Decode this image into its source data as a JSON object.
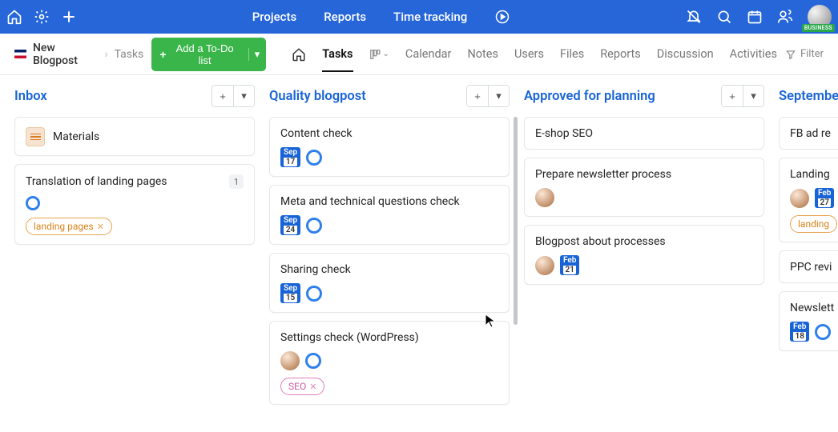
{
  "topnav": {
    "links": [
      "Projects",
      "Reports",
      "Time tracking"
    ],
    "avatar_badge": "BUSINESS"
  },
  "breadcrumb": {
    "project": "New Blogpost",
    "section": "Tasks"
  },
  "add_todo_label": "Add a To-Do list",
  "tabs": [
    "Tasks",
    "Calendar",
    "Notes",
    "Users",
    "Files",
    "Reports",
    "Discussion",
    "Activities"
  ],
  "filter_label": "Filter",
  "columns": [
    {
      "title": "Inbox",
      "cards": [
        {
          "title": "Materials",
          "icon": "materials"
        },
        {
          "title": "Translation of landing pages",
          "count": "1",
          "ring": true,
          "tag": {
            "text": "landing pages",
            "style": "orange"
          }
        }
      ]
    },
    {
      "title": "Quality blogpost",
      "cards": [
        {
          "title": "Content check",
          "date": {
            "month": "Sep",
            "day": "17"
          },
          "ring": true
        },
        {
          "title": "Meta and technical questions check",
          "date": {
            "month": "Sep",
            "day": "24"
          },
          "ring": true
        },
        {
          "title": "Sharing check",
          "date": {
            "month": "Sep",
            "day": "15"
          },
          "ring": true
        },
        {
          "title": "Settings check (WordPress)",
          "avatar": true,
          "ring": true,
          "tag": {
            "text": "SEO",
            "style": "pink"
          }
        }
      ]
    },
    {
      "title": "Approved for planning",
      "cards": [
        {
          "title": "E-shop SEO"
        },
        {
          "title": "Prepare newsletter process",
          "avatar": true
        },
        {
          "title": "Blogpost about processes",
          "avatar": true,
          "date": {
            "month": "Feb",
            "day": "21"
          }
        }
      ]
    },
    {
      "title": "September",
      "cards": [
        {
          "title": "FB ad re"
        },
        {
          "title": "Landing",
          "avatar": true,
          "date": {
            "month": "Feb",
            "day": "27"
          },
          "tag": {
            "text": "landing",
            "style": "orange"
          }
        },
        {
          "title": "PPC revi"
        },
        {
          "title": "Newslett",
          "date": {
            "month": "Feb",
            "day": "18"
          },
          "ring": true
        }
      ]
    }
  ]
}
